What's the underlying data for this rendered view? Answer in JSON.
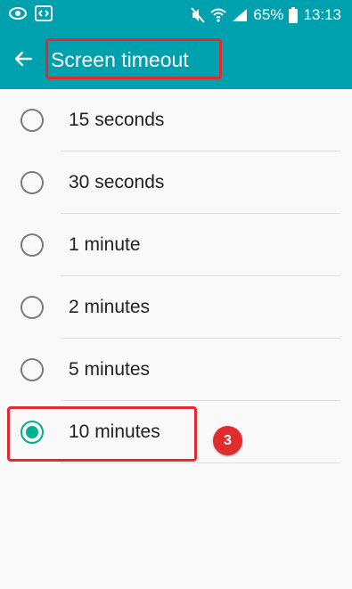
{
  "status_bar": {
    "battery_percent": "65%",
    "time": "13:13",
    "icons": [
      "eye-icon",
      "screen-mirror-icon",
      "mute-icon",
      "wifi-icon",
      "signal-icon",
      "battery-icon"
    ]
  },
  "app_bar": {
    "title": "Screen timeout",
    "back_icon": "arrow-left-icon"
  },
  "options": [
    {
      "label": "15 seconds",
      "selected": false
    },
    {
      "label": "30 seconds",
      "selected": false
    },
    {
      "label": "1 minute",
      "selected": false
    },
    {
      "label": "2 minutes",
      "selected": false
    },
    {
      "label": "5 minutes",
      "selected": false
    },
    {
      "label": "10 minutes",
      "selected": true
    }
  ],
  "annotation": {
    "step_number": "3"
  },
  "colors": {
    "app_bar": "#00a1ae",
    "radio_selected": "#00b08e",
    "highlight": "#e42a2f"
  }
}
